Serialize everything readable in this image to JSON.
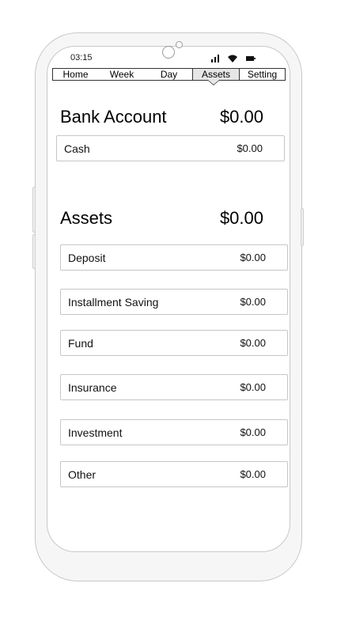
{
  "status": {
    "time": "03:15"
  },
  "tabs": [
    {
      "label": "Home"
    },
    {
      "label": "Week"
    },
    {
      "label": "Day"
    },
    {
      "label": "Assets"
    },
    {
      "label": "Setting"
    }
  ],
  "active_tab": "Assets",
  "bank": {
    "title": "Bank Account",
    "total": "$0.00",
    "items": [
      {
        "label": "Cash",
        "value": "$0.00"
      }
    ]
  },
  "assets": {
    "title": "Assets",
    "total": "$0.00",
    "items": [
      {
        "label": "Deposit",
        "value": "$0.00"
      },
      {
        "label": "Installment Saving",
        "value": "$0.00"
      },
      {
        "label": "Fund",
        "value": "$0.00"
      },
      {
        "label": "Insurance",
        "value": "$0.00"
      },
      {
        "label": "Investment",
        "value": "$0.00"
      },
      {
        "label": "Other",
        "value": "$0.00"
      }
    ]
  },
  "icons": [
    "signal-icon",
    "wifi-icon",
    "battery-icon",
    "camera-icon"
  ]
}
